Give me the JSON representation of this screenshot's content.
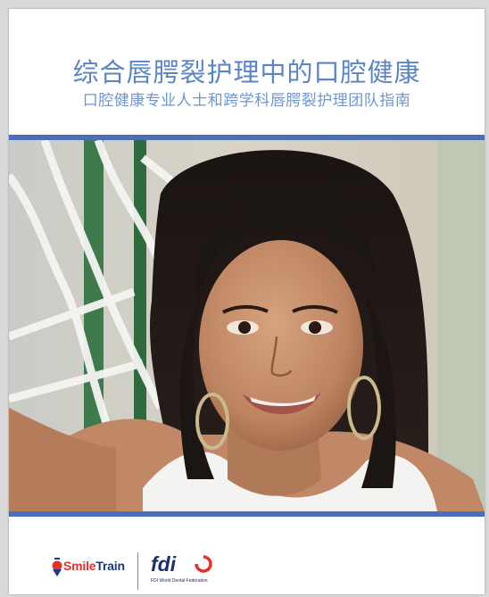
{
  "cover": {
    "title": "综合唇腭裂护理中的口腔健康",
    "subtitle": "口腔健康专业人士和跨学科唇腭裂护理团队指南"
  },
  "colors": {
    "title": "#5b84c4",
    "band": "#4a6fb5",
    "smile_red": "#e1322e",
    "navy": "#1b2f6b"
  },
  "logos": {
    "smiletrain": {
      "smile": "Smile",
      "train": "Train"
    },
    "fdi": {
      "name": "fdi",
      "sub": "FDI World Dental Federation"
    }
  },
  "photo": {
    "icon": "girl-portrait-photo"
  }
}
